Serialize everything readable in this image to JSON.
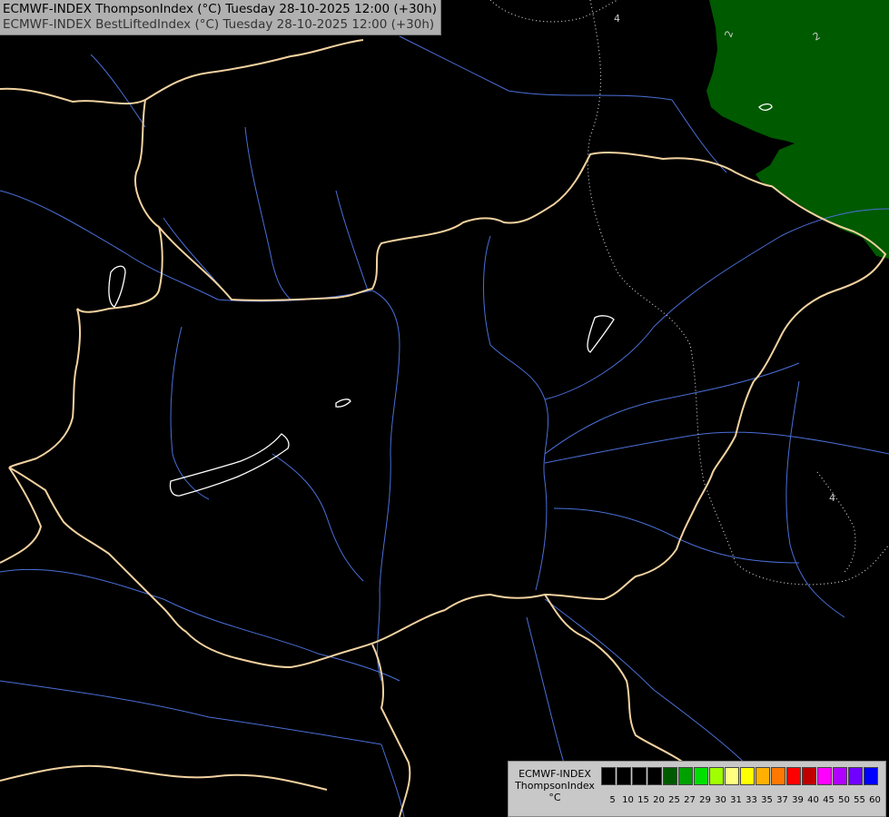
{
  "header": {
    "line1": "ECMWF-INDEX ThompsonIndex (°C) Tuesday 28-10-2025 12:00 (+30h)",
    "line2": "ECMWF-INDEX BestLiftedIndex (°C) Tuesday 28-10-2025 12:00 (+30h)"
  },
  "map": {
    "background_color": "#000000",
    "border_color": "#f2d2a0",
    "river_color": "#4a6fd8",
    "lake_outline_color": "#ffffff",
    "shaded_region_color": "#005a00",
    "contour_labels": [
      "2",
      "2",
      "4",
      "4"
    ]
  },
  "legend": {
    "title_lines": [
      "ECMWF-INDEX",
      "ThompsonIndex",
      "°C"
    ],
    "ticks": [
      "5",
      "10",
      "15",
      "20",
      "25",
      "27",
      "29",
      "30",
      "31",
      "33",
      "35",
      "37",
      "39",
      "40",
      "45",
      "50",
      "55",
      "60"
    ],
    "colors": [
      "#000000",
      "#000000",
      "#000000",
      "#000000",
      "#005a00",
      "#00a000",
      "#00e000",
      "#a0ff00",
      "#ffff80",
      "#ffff00",
      "#ffb000",
      "#ff7800",
      "#ff0000",
      "#c00000",
      "#ff00ff",
      "#b000ff",
      "#7000ff",
      "#0000ff"
    ]
  }
}
